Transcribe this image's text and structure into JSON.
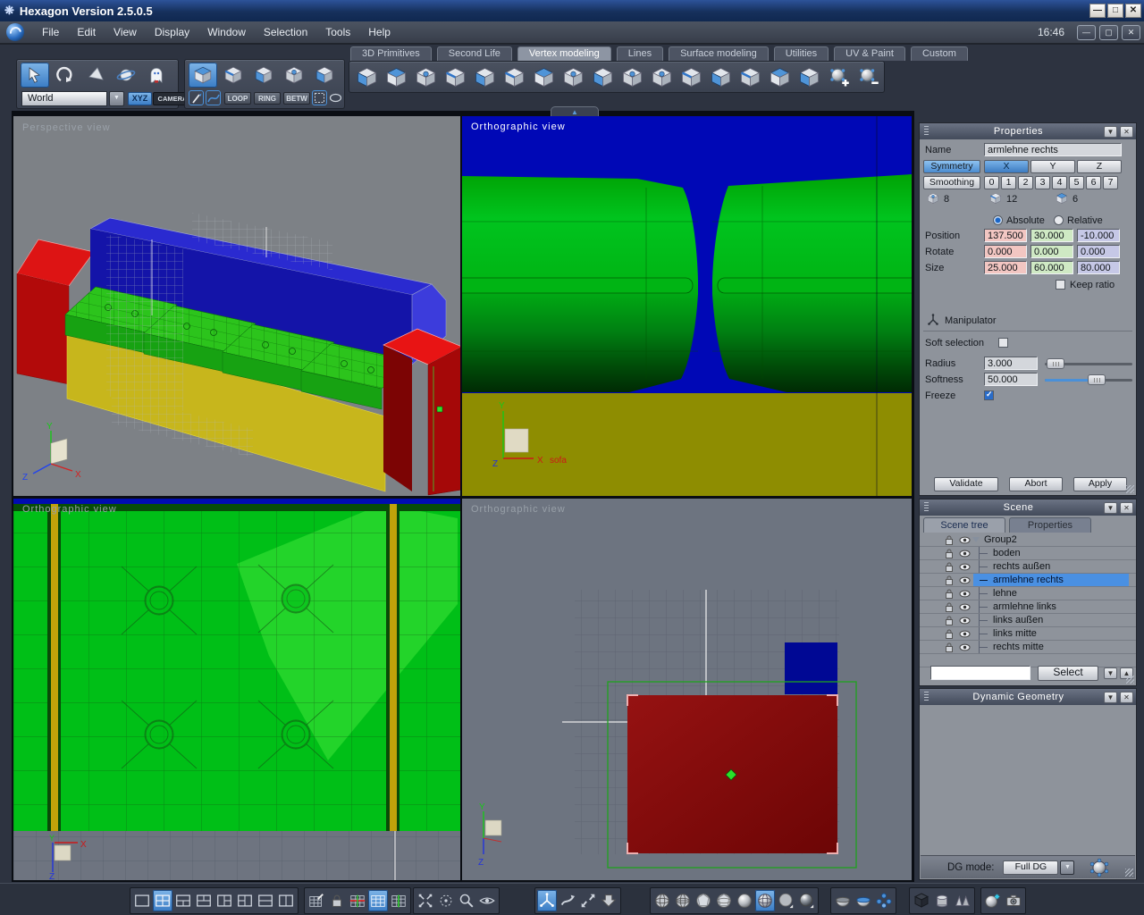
{
  "window": {
    "title": "Hexagon Version 2.5.0.5",
    "clock": "16:46"
  },
  "menu": {
    "items": [
      "File",
      "Edit",
      "View",
      "Display",
      "Window",
      "Selection",
      "Tools",
      "Help"
    ]
  },
  "tabs": {
    "active": "Vertex modeling",
    "items": [
      {
        "label": "3D Primitives"
      },
      {
        "label": "Second Life"
      },
      {
        "label": "Vertex modeling"
      },
      {
        "label": "Lines"
      },
      {
        "label": "Surface modeling"
      },
      {
        "label": "Utilities"
      },
      {
        "label": "UV & Paint"
      },
      {
        "label": "Custom"
      }
    ]
  },
  "toolbar": {
    "space_value": "World",
    "xyz": "XYZ",
    "camera": "CAMERA",
    "loop": "LOOP",
    "ring": "RING",
    "betw": "BETW"
  },
  "viewports": {
    "perspective": {
      "label": "Perspective view"
    },
    "front": {
      "label": "Orthographic view",
      "object_tag": "sofa"
    },
    "top": {
      "label": "Orthographic view"
    },
    "side": {
      "label": "Orthographic view"
    },
    "axis": {
      "x": "X",
      "y": "Y",
      "z": "Z"
    }
  },
  "properties": {
    "title": "Properties",
    "name_label": "Name",
    "name_value": "armlehne rechts",
    "symmetry": "Symmetry",
    "axis_x": "X",
    "axis_y": "Y",
    "axis_z": "Z",
    "smoothing": "Smoothing",
    "levels": [
      "0",
      "1",
      "2",
      "3",
      "4",
      "5",
      "6",
      "7"
    ],
    "counts": {
      "points": "8",
      "edges": "12",
      "faces": "6"
    },
    "absolute": "Absolute",
    "relative": "Relative",
    "position_label": "Position",
    "rotate_label": "Rotate",
    "size_label": "Size",
    "position": [
      "137.500",
      "30.000",
      "-10.000"
    ],
    "rotate": [
      "0.000",
      "0.000",
      "0.000"
    ],
    "size": [
      "25.000",
      "60.000",
      "80.000"
    ],
    "keep_ratio": "Keep ratio",
    "manipulator": "Manipulator",
    "soft_selection": "Soft selection",
    "radius_label": "Radius",
    "radius": "3.000",
    "softness_label": "Softness",
    "softness": "50.000",
    "freeze": "Freeze",
    "validate": "Validate",
    "abort": "Abort",
    "apply": "Apply"
  },
  "scene": {
    "title": "Scene",
    "tab_tree": "Scene tree",
    "tab_props": "Properties",
    "selected": "armlehne rechts",
    "items": [
      {
        "label": "Group2"
      },
      {
        "label": "boden"
      },
      {
        "label": "rechts außen"
      },
      {
        "label": "armlehne rechts"
      },
      {
        "label": "lehne"
      },
      {
        "label": "armlehne links"
      },
      {
        "label": "links außen"
      },
      {
        "label": "links mitte"
      },
      {
        "label": "rechts mitte"
      }
    ],
    "select_button": "Select"
  },
  "dynamic_geometry": {
    "title": "Dynamic Geometry",
    "mode_label": "DG mode:",
    "mode_value": "Full DG"
  },
  "colors": {
    "accent_blue": "#4a90d8",
    "selection_blue": "#4a90e2",
    "field_x": "#f2c6c2",
    "field_y": "#cfe9c4",
    "field_z": "#c6c8e6",
    "viewport_red": "#8a0606",
    "viewport_green": "#00c41e",
    "viewport_blue": "#0008b0",
    "viewport_olive": "#8f8e02"
  }
}
